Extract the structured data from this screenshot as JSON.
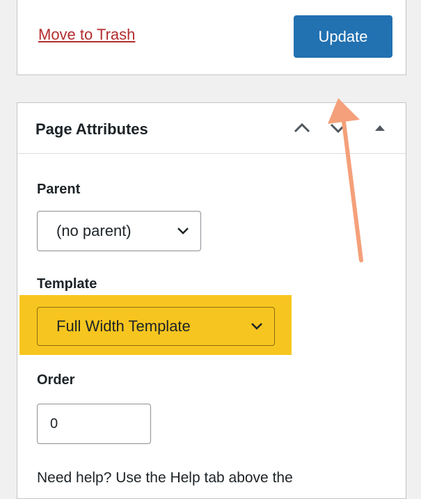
{
  "publish_box": {
    "trash_label": "Move to Trash",
    "update_label": "Update"
  },
  "page_attributes": {
    "title": "Page Attributes",
    "parent": {
      "label": "Parent",
      "selected": "(no parent)"
    },
    "template": {
      "label": "Template",
      "selected": "Full Width Template"
    },
    "order": {
      "label": "Order",
      "value": "0"
    },
    "help_text": "Need help? Use the Help tab above the"
  },
  "colors": {
    "primary_button": "#2271b1",
    "trash_link": "#b32d2e",
    "highlight": "#f7c51f",
    "annotation_arrow": "#f4a07a"
  },
  "icons": [
    "chevron-up-icon",
    "chevron-down-icon",
    "triangle-up-icon",
    "annotation-arrow"
  ]
}
